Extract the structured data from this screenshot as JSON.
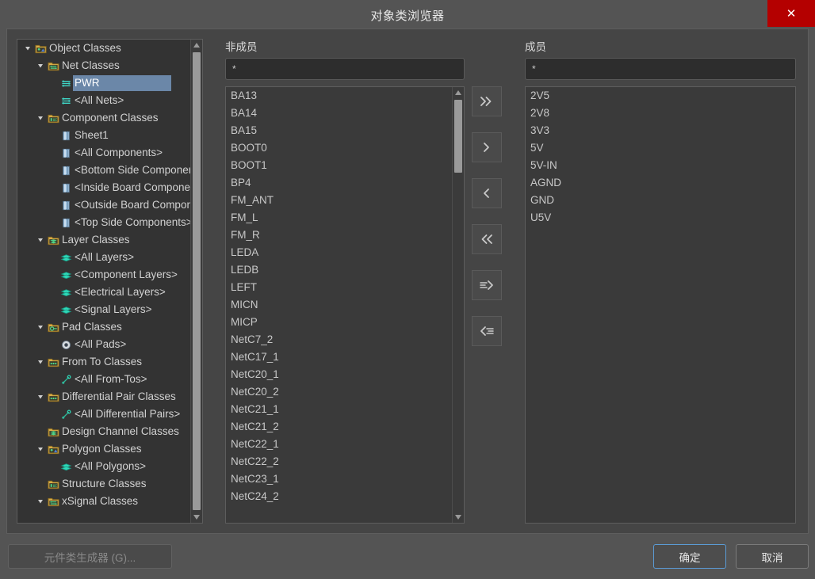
{
  "window": {
    "title": "对象类浏览器",
    "close_label": "✕",
    "close_icon": "close-icon",
    "accent_red": "#b40000",
    "selection_blue": "#6b87a8",
    "focus_blue": "#5b9bd5"
  },
  "tree": {
    "nodes": [
      {
        "label": "Object Classes",
        "indent": 0,
        "expander": "down",
        "icon": "polygon-class-folder-icon",
        "selected": false
      },
      {
        "label": "Net Classes",
        "indent": 1,
        "expander": "down",
        "icon": "net-class-folder-icon",
        "selected": false
      },
      {
        "label": "PWR",
        "indent": 2,
        "expander": "none",
        "icon": "net-icon",
        "selected": true
      },
      {
        "label": "<All Nets>",
        "indent": 2,
        "expander": "none",
        "icon": "net-icon",
        "selected": false
      },
      {
        "label": "Component Classes",
        "indent": 1,
        "expander": "down",
        "icon": "component-class-folder-icon",
        "selected": false
      },
      {
        "label": "Sheet1",
        "indent": 2,
        "expander": "none",
        "icon": "component-icon",
        "selected": false
      },
      {
        "label": "<All Components>",
        "indent": 2,
        "expander": "none",
        "icon": "component-icon",
        "selected": false
      },
      {
        "label": "<Bottom Side Components>",
        "indent": 2,
        "expander": "none",
        "icon": "component-icon",
        "selected": false
      },
      {
        "label": "<Inside Board Components>",
        "indent": 2,
        "expander": "none",
        "icon": "component-icon",
        "selected": false
      },
      {
        "label": "<Outside Board Components>",
        "indent": 2,
        "expander": "none",
        "icon": "component-icon",
        "selected": false
      },
      {
        "label": "<Top Side Components>",
        "indent": 2,
        "expander": "none",
        "icon": "component-icon",
        "selected": false
      },
      {
        "label": "Layer Classes",
        "indent": 1,
        "expander": "down",
        "icon": "layer-class-folder-icon",
        "selected": false
      },
      {
        "label": "<All Layers>",
        "indent": 2,
        "expander": "none",
        "icon": "layer-icon",
        "selected": false
      },
      {
        "label": "<Component Layers>",
        "indent": 2,
        "expander": "none",
        "icon": "layer-icon",
        "selected": false
      },
      {
        "label": "<Electrical Layers>",
        "indent": 2,
        "expander": "none",
        "icon": "layer-icon",
        "selected": false
      },
      {
        "label": "<Signal Layers>",
        "indent": 2,
        "expander": "none",
        "icon": "layer-icon",
        "selected": false
      },
      {
        "label": "Pad Classes",
        "indent": 1,
        "expander": "down",
        "icon": "pad-class-folder-icon",
        "selected": false
      },
      {
        "label": "<All Pads>",
        "indent": 2,
        "expander": "none",
        "icon": "pad-icon",
        "selected": false
      },
      {
        "label": "From To Classes",
        "indent": 1,
        "expander": "down",
        "icon": "fromto-class-folder-icon",
        "selected": false
      },
      {
        "label": "<All From-Tos>",
        "indent": 2,
        "expander": "none",
        "icon": "fromto-icon",
        "selected": false
      },
      {
        "label": "Differential Pair Classes",
        "indent": 1,
        "expander": "down",
        "icon": "fromto-class-folder-icon",
        "selected": false
      },
      {
        "label": "<All Differential Pairs>",
        "indent": 2,
        "expander": "none",
        "icon": "fromto-icon",
        "selected": false
      },
      {
        "label": "Design Channel Classes",
        "indent": 1,
        "expander": "none",
        "icon": "layer-class-folder-icon",
        "selected": false
      },
      {
        "label": "Polygon Classes",
        "indent": 1,
        "expander": "down",
        "icon": "polygon-class-folder-icon",
        "selected": false
      },
      {
        "label": "<All Polygons>",
        "indent": 2,
        "expander": "none",
        "icon": "layer-icon",
        "selected": false
      },
      {
        "label": "Structure Classes",
        "indent": 1,
        "expander": "none",
        "icon": "component-class-folder-icon",
        "selected": false
      },
      {
        "label": "xSignal Classes",
        "indent": 1,
        "expander": "down",
        "icon": "net-class-folder-icon",
        "selected": false
      }
    ],
    "scrollbar": {
      "up_arrow": "scroll-up-icon",
      "down_arrow": "scroll-down-icon"
    }
  },
  "nonmembers": {
    "title": "非成员",
    "filter_value": "*",
    "filter_placeholder": "*",
    "items": [
      "BA13",
      "BA14",
      "BA15",
      "BOOT0",
      "BOOT1",
      "BP4",
      "FM_ANT",
      "FM_L",
      "FM_R",
      "LEDA",
      "LEDB",
      "LEFT",
      "MICN",
      "MICP",
      "NetC7_2",
      "NetC17_1",
      "NetC20_1",
      "NetC20_2",
      "NetC21_1",
      "NetC21_2",
      "NetC22_1",
      "NetC22_2",
      "NetC23_1",
      "NetC24_2"
    ]
  },
  "members": {
    "title": "成员",
    "filter_value": "*",
    "filter_placeholder": "*",
    "items": [
      "2V5",
      "2V8",
      "3V3",
      "5V",
      "5V-IN",
      "AGND",
      "GND",
      "U5V"
    ]
  },
  "transfer_buttons": [
    {
      "name": "add-all-button",
      "icon": "double-chevron-right-icon"
    },
    {
      "name": "add-selected-button",
      "icon": "chevron-right-icon"
    },
    {
      "name": "remove-selected-button",
      "icon": "chevron-left-icon"
    },
    {
      "name": "remove-all-button",
      "icon": "double-chevron-left-icon"
    },
    {
      "name": "add-list-button",
      "icon": "lines-arrow-right-icon"
    },
    {
      "name": "remove-list-button",
      "icon": "arrow-left-lines-icon"
    }
  ],
  "footer": {
    "generator_label": "元件类生成器 (G)...",
    "ok_label": "确定",
    "cancel_label": "取消"
  }
}
